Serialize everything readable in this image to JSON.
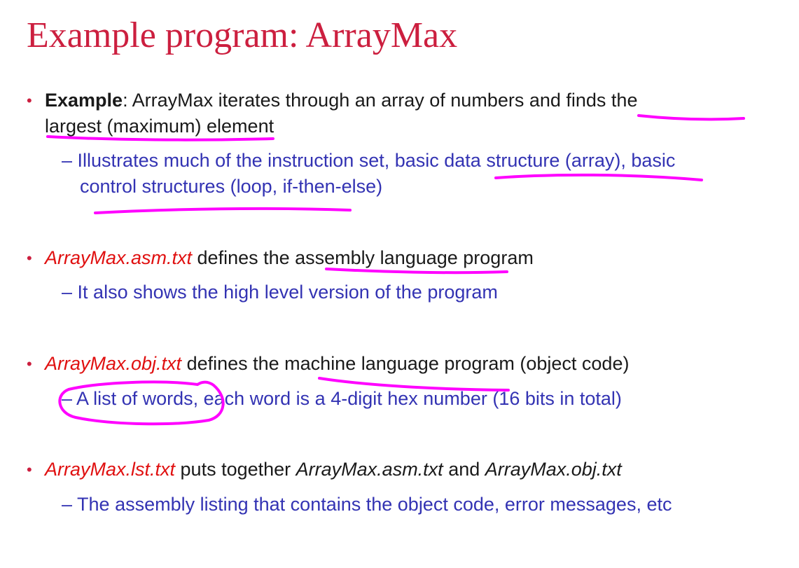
{
  "slide": {
    "title": "Example program: ArrayMax",
    "bullet_marker": "•",
    "dash": "–",
    "annotation_color": "#ff00ff",
    "title_color": "#cc1f3f",
    "filename_color": "#e01010",
    "sub_text_color": "#3333b3"
  },
  "bullets": [
    {
      "lead": "Example",
      "colon": ":",
      "text_part1": " ArrayMax iterates through an array of numbers and finds the",
      "text_line2": "largest (maximum) element",
      "sub_line1": "Illustrates much of the instruction set, basic data structure (array), basic",
      "sub_line2": "control structures (loop, if-then-else)"
    },
    {
      "filename": "ArrayMax.asm.txt",
      "text": " defines the assembly language program",
      "sub": "It also shows the high level version of the program"
    },
    {
      "filename": "ArrayMax.obj.txt",
      "text": " defines the machine language program (object code)",
      "sub": "A list of words, each word is a 4-digit hex number (16 bits in total)"
    },
    {
      "filename": "ArrayMax.lst.txt",
      "text_a": " puts together ",
      "file_a": "ArrayMax.asm.txt",
      "text_b": " and ",
      "file_b": "ArrayMax.obj.txt",
      "sub": "The assembly listing that contains the object code, error messages, etc"
    }
  ]
}
